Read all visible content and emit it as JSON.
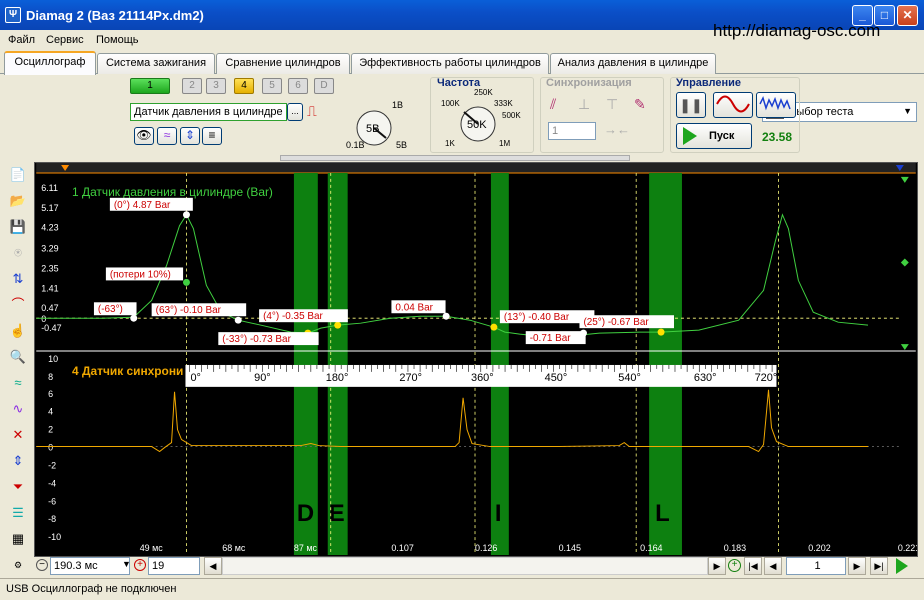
{
  "window": {
    "title": "Diamag 2 (Ваз 21114Px.dm2)",
    "app_icon": "Ψ",
    "min": "_",
    "max": "□",
    "close": "✕",
    "url": "http://diamag-osc.com"
  },
  "menu": [
    "Файл",
    "Сервис",
    "Помощь"
  ],
  "tabs": [
    "Осциллограф",
    "Система зажигания",
    "Сравнение цилиндров",
    "Эффективность работы цилиндров",
    "Анализ давления в цилиндре"
  ],
  "test_select": {
    "label": "Выбор теста"
  },
  "channels": {
    "buttons": [
      "1",
      "2",
      "3",
      "4",
      "5",
      "6",
      "D"
    ],
    "active": [
      "1",
      "4"
    ],
    "sensor": "Датчик давления в цилиндре",
    "sensor_btn": "...",
    "knob": {
      "value": "5В",
      "min": "0.1В",
      "max": "5В",
      "top": "1В"
    }
  },
  "freq": {
    "title": "Частота",
    "value": "50K",
    "labels": {
      "l100k": "100K",
      "l250k": "250K",
      "l333k": "333K",
      "l500k": "500K",
      "l1k": "1K",
      "l1m": "1M"
    }
  },
  "sync": {
    "title": "Синхронизация",
    "value": "1"
  },
  "control": {
    "title": "Управление",
    "start": "Пуск",
    "counter": "23.58"
  },
  "scope": {
    "ch1_label": "1 Датчик давления в цилиндре (Bar)",
    "ch4_label": "4 Датчик синхрони",
    "ch1_y": [
      "6.11",
      "5.17",
      "4.23",
      "3.29",
      "2.35",
      "1.41",
      "0.47",
      "0",
      "-0.47"
    ],
    "ch4_y": [
      "10",
      "8",
      "6",
      "4",
      "2",
      "0",
      "-2",
      "-4",
      "-6",
      "-8",
      "-10"
    ],
    "x_ticks": [
      "49 мс",
      "68 мс",
      "87 мс",
      "0.107",
      "0.126",
      "0.145",
      "0.164",
      "0.183",
      "0.202",
      "0.221"
    ],
    "angle_ticks": [
      "0°",
      "90°",
      "180°",
      "270°",
      "360°",
      "450°",
      "540°",
      "630°",
      "720°"
    ],
    "zones": [
      "D",
      "E",
      "I",
      "L"
    ],
    "annotations": {
      "a1": "(0°) 4.87 Bar",
      "a2": "(потери 10%)",
      "a3": "(-63°)",
      "a4": "(63°) -0.10 Bar",
      "a5": "(-33°) -0.73 Bar",
      "a6": "(4°) -0.35 Bar",
      "a7": "0.04 Bar",
      "a8": "(13°) -0.40 Bar",
      "a9": "-0.71 Bar",
      "a10": "(25°) -0.67 Bar"
    }
  },
  "bottom": {
    "time": "190.3 мс",
    "count": "19",
    "page": "1"
  },
  "status": {
    "text": "USB Осциллограф не подключен"
  }
}
